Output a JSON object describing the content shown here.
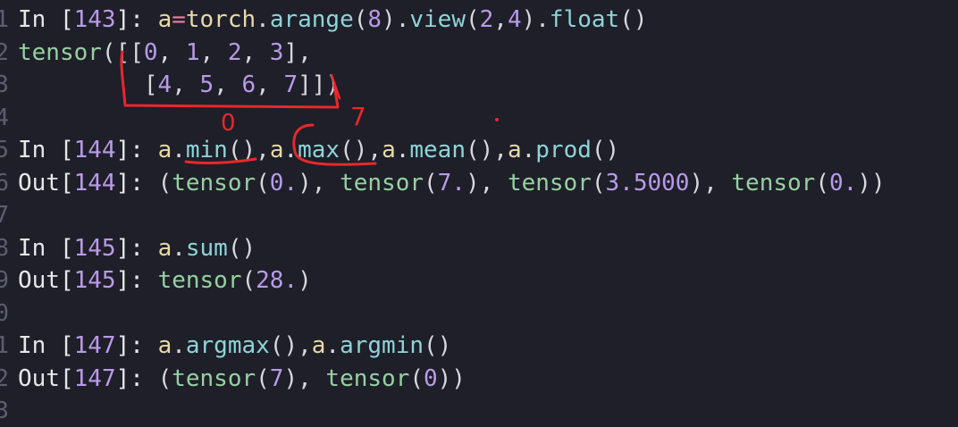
{
  "lines": [
    {
      "gutter": "1",
      "segments": [
        {
          "t": "In [",
          "c": "tok-plain"
        },
        {
          "t": "143",
          "c": "tok-num"
        },
        {
          "t": "]: ",
          "c": "tok-plain"
        },
        {
          "t": "a",
          "c": "tok-var"
        },
        {
          "t": "=",
          "c": "tok-op"
        },
        {
          "t": "torch",
          "c": "tok-var"
        },
        {
          "t": ".",
          "c": "tok-punc"
        },
        {
          "t": "arange",
          "c": "tok-fn"
        },
        {
          "t": "(",
          "c": "tok-punc"
        },
        {
          "t": "8",
          "c": "tok-num"
        },
        {
          "t": ").",
          "c": "tok-punc"
        },
        {
          "t": "view",
          "c": "tok-fn"
        },
        {
          "t": "(",
          "c": "tok-punc"
        },
        {
          "t": "2",
          "c": "tok-num"
        },
        {
          "t": ",",
          "c": "tok-punc"
        },
        {
          "t": "4",
          "c": "tok-num"
        },
        {
          "t": ").",
          "c": "tok-punc"
        },
        {
          "t": "float",
          "c": "tok-fn"
        },
        {
          "t": "()",
          "c": "tok-punc"
        }
      ]
    },
    {
      "gutter": "2",
      "segments": [
        {
          "t": "tensor",
          "c": "tok-green"
        },
        {
          "t": "([[",
          "c": "tok-punc"
        },
        {
          "t": "0",
          "c": "tok-num"
        },
        {
          "t": ", ",
          "c": "tok-punc"
        },
        {
          "t": "1",
          "c": "tok-num"
        },
        {
          "t": ", ",
          "c": "tok-punc"
        },
        {
          "t": "2",
          "c": "tok-num"
        },
        {
          "t": ", ",
          "c": "tok-punc"
        },
        {
          "t": "3",
          "c": "tok-num"
        },
        {
          "t": "],",
          "c": "tok-punc"
        }
      ]
    },
    {
      "gutter": "3",
      "segments": [
        {
          "t": "         [",
          "c": "tok-punc"
        },
        {
          "t": "4",
          "c": "tok-num"
        },
        {
          "t": ", ",
          "c": "tok-punc"
        },
        {
          "t": "5",
          "c": "tok-num"
        },
        {
          "t": ", ",
          "c": "tok-punc"
        },
        {
          "t": "6",
          "c": "tok-num"
        },
        {
          "t": ", ",
          "c": "tok-punc"
        },
        {
          "t": "7",
          "c": "tok-num"
        },
        {
          "t": "]])",
          "c": "tok-punc"
        }
      ]
    },
    {
      "gutter": "4",
      "segments": []
    },
    {
      "gutter": "5",
      "segments": [
        {
          "t": "In [",
          "c": "tok-plain"
        },
        {
          "t": "144",
          "c": "tok-num"
        },
        {
          "t": "]: ",
          "c": "tok-plain"
        },
        {
          "t": "a",
          "c": "tok-var"
        },
        {
          "t": ".",
          "c": "tok-punc"
        },
        {
          "t": "min",
          "c": "tok-fn"
        },
        {
          "t": "(),",
          "c": "tok-punc"
        },
        {
          "t": "a",
          "c": "tok-var"
        },
        {
          "t": ".",
          "c": "tok-punc"
        },
        {
          "t": "max",
          "c": "tok-fn"
        },
        {
          "t": "(),",
          "c": "tok-punc"
        },
        {
          "t": "a",
          "c": "tok-var"
        },
        {
          "t": ".",
          "c": "tok-punc"
        },
        {
          "t": "mean",
          "c": "tok-fn"
        },
        {
          "t": "(),",
          "c": "tok-punc"
        },
        {
          "t": "a",
          "c": "tok-var"
        },
        {
          "t": ".",
          "c": "tok-punc"
        },
        {
          "t": "prod",
          "c": "tok-fn"
        },
        {
          "t": "()",
          "c": "tok-punc"
        }
      ]
    },
    {
      "gutter": "6",
      "segments": [
        {
          "t": "Out[",
          "c": "tok-plain"
        },
        {
          "t": "144",
          "c": "tok-num"
        },
        {
          "t": "]: ",
          "c": "tok-plain"
        },
        {
          "t": "(",
          "c": "tok-punc"
        },
        {
          "t": "tensor",
          "c": "tok-green"
        },
        {
          "t": "(",
          "c": "tok-punc"
        },
        {
          "t": "0.",
          "c": "tok-num"
        },
        {
          "t": "), ",
          "c": "tok-punc"
        },
        {
          "t": "tensor",
          "c": "tok-green"
        },
        {
          "t": "(",
          "c": "tok-punc"
        },
        {
          "t": "7.",
          "c": "tok-num"
        },
        {
          "t": "), ",
          "c": "tok-punc"
        },
        {
          "t": "tensor",
          "c": "tok-green"
        },
        {
          "t": "(",
          "c": "tok-punc"
        },
        {
          "t": "3.5000",
          "c": "tok-num"
        },
        {
          "t": "), ",
          "c": "tok-punc"
        },
        {
          "t": "tensor",
          "c": "tok-green"
        },
        {
          "t": "(",
          "c": "tok-punc"
        },
        {
          "t": "0.",
          "c": "tok-num"
        },
        {
          "t": "))",
          "c": "tok-punc"
        }
      ]
    },
    {
      "gutter": "7",
      "segments": []
    },
    {
      "gutter": "8",
      "segments": [
        {
          "t": "In [",
          "c": "tok-plain"
        },
        {
          "t": "145",
          "c": "tok-num"
        },
        {
          "t": "]: ",
          "c": "tok-plain"
        },
        {
          "t": "a",
          "c": "tok-var"
        },
        {
          "t": ".",
          "c": "tok-punc"
        },
        {
          "t": "sum",
          "c": "tok-fn"
        },
        {
          "t": "()",
          "c": "tok-punc"
        }
      ]
    },
    {
      "gutter": "9",
      "segments": [
        {
          "t": "Out[",
          "c": "tok-plain"
        },
        {
          "t": "145",
          "c": "tok-num"
        },
        {
          "t": "]: ",
          "c": "tok-plain"
        },
        {
          "t": "tensor",
          "c": "tok-green"
        },
        {
          "t": "(",
          "c": "tok-punc"
        },
        {
          "t": "28.",
          "c": "tok-num"
        },
        {
          "t": ")",
          "c": "tok-punc"
        }
      ]
    },
    {
      "gutter": "0",
      "segments": []
    },
    {
      "gutter": "1",
      "segments": [
        {
          "t": "In [",
          "c": "tok-plain"
        },
        {
          "t": "147",
          "c": "tok-num"
        },
        {
          "t": "]: ",
          "c": "tok-plain"
        },
        {
          "t": "a",
          "c": "tok-var"
        },
        {
          "t": ".",
          "c": "tok-punc"
        },
        {
          "t": "argmax",
          "c": "tok-fn"
        },
        {
          "t": "(),",
          "c": "tok-punc"
        },
        {
          "t": "a",
          "c": "tok-var"
        },
        {
          "t": ".",
          "c": "tok-punc"
        },
        {
          "t": "argmin",
          "c": "tok-fn"
        },
        {
          "t": "()",
          "c": "tok-punc"
        }
      ]
    },
    {
      "gutter": "2",
      "segments": [
        {
          "t": "Out[",
          "c": "tok-plain"
        },
        {
          "t": "147",
          "c": "tok-num"
        },
        {
          "t": "]: ",
          "c": "tok-plain"
        },
        {
          "t": "(",
          "c": "tok-punc"
        },
        {
          "t": "tensor",
          "c": "tok-green"
        },
        {
          "t": "(",
          "c": "tok-punc"
        },
        {
          "t": "7",
          "c": "tok-num"
        },
        {
          "t": "), ",
          "c": "tok-punc"
        },
        {
          "t": "tensor",
          "c": "tok-green"
        },
        {
          "t": "(",
          "c": "tok-punc"
        },
        {
          "t": "0",
          "c": "tok-num"
        },
        {
          "t": "))",
          "c": "tok-punc"
        }
      ]
    },
    {
      "gutter": "3",
      "segments": []
    }
  ],
  "annotations": {
    "label_zero": "0",
    "label_seven": "7",
    "ink_color": "#e8282b"
  }
}
